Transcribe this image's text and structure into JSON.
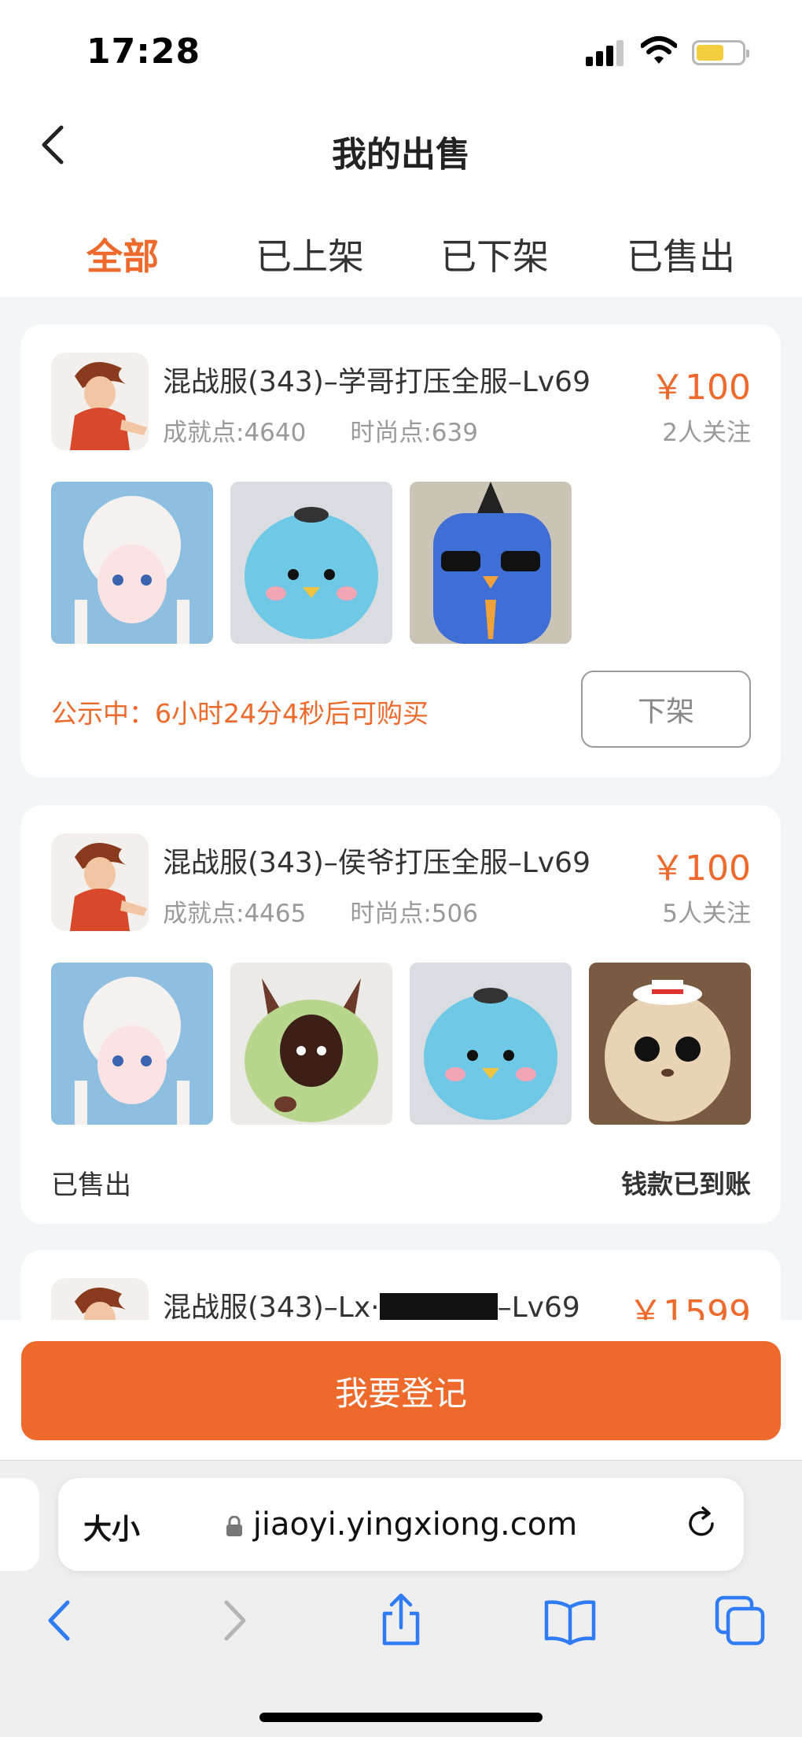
{
  "status_bar": {
    "time": "17:28"
  },
  "nav": {
    "title": "我的出售"
  },
  "tabs": [
    {
      "label": "全部",
      "active": true
    },
    {
      "label": "已上架",
      "active": false
    },
    {
      "label": "已下架",
      "active": false
    },
    {
      "label": "已售出",
      "active": false
    }
  ],
  "listings": [
    {
      "title": "混战服(343)–学哥打压全服–Lv69",
      "price": "￥100",
      "achievement": "成就点:4640",
      "fashion": "时尚点:639",
      "followers": "2人关注",
      "notice": "公示中：6小时24分4秒后可购买",
      "action_label": "下架"
    },
    {
      "title": "混战服(343)–侯爷打压全服–Lv69",
      "price": "￥100",
      "achievement": "成就点:4465",
      "fashion": "时尚点:506",
      "followers": "5人关注",
      "status": "已售出",
      "payment": "钱款已到账"
    },
    {
      "title_prefix": "混战服(343)–Lx·",
      "title_suffix": "–Lv69",
      "price": "￥1599"
    }
  ],
  "register_button": "我要登记",
  "browser": {
    "text_size": "大小",
    "url": "jiaoyi.yingxiong.com"
  },
  "colors": {
    "accent": "#ee6a2c",
    "ios_blue": "#2f7cf6"
  }
}
